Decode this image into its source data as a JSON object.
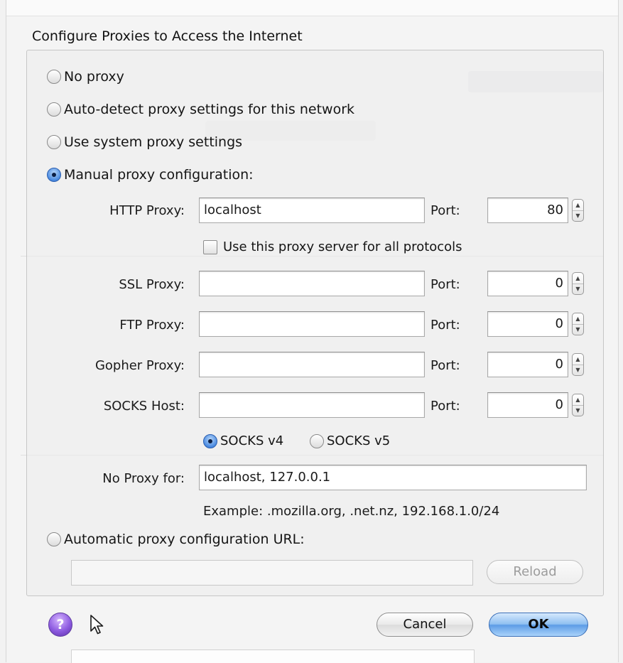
{
  "dialog": {
    "group_title": "Configure Proxies to Access the Internet",
    "options": {
      "no_proxy": "No proxy",
      "auto_detect": "Auto-detect proxy settings for this network",
      "system": "Use system proxy settings",
      "manual": "Manual proxy configuration:",
      "auto_url": "Automatic proxy configuration URL:"
    },
    "selected_option": "manual",
    "http": {
      "label": "HTTP Proxy:",
      "value": "localhost",
      "port_label": "Port:",
      "port": "80"
    },
    "use_for_all": {
      "label": "Use this proxy server for all protocols",
      "checked": false
    },
    "ssl": {
      "label": "SSL Proxy:",
      "value": "",
      "port_label": "Port:",
      "port": "0"
    },
    "ftp": {
      "label": "FTP Proxy:",
      "value": "",
      "port_label": "Port:",
      "port": "0"
    },
    "gopher": {
      "label": "Gopher Proxy:",
      "value": "",
      "port_label": "Port:",
      "port": "0"
    },
    "socks": {
      "label": "SOCKS Host:",
      "value": "",
      "port_label": "Port:",
      "port": "0"
    },
    "socks_version": {
      "v4": "SOCKS v4",
      "v5": "SOCKS v5",
      "selected": "v4"
    },
    "no_proxy_for": {
      "label": "No Proxy for:",
      "value": "localhost, 127.0.0.1"
    },
    "example": "Example: .mozilla.org, .net.nz, 192.168.1.0/24",
    "auto_url_value": "",
    "buttons": {
      "reload": "Reload",
      "cancel": "Cancel",
      "ok": "OK",
      "help": "?"
    },
    "icons": {
      "help": "help-icon",
      "cursor": "mouse-pointer-icon",
      "stepper": "stepper-arrows-icon"
    },
    "colors": {
      "accent": "#5d9ce6",
      "help": "#8d5be0"
    }
  }
}
